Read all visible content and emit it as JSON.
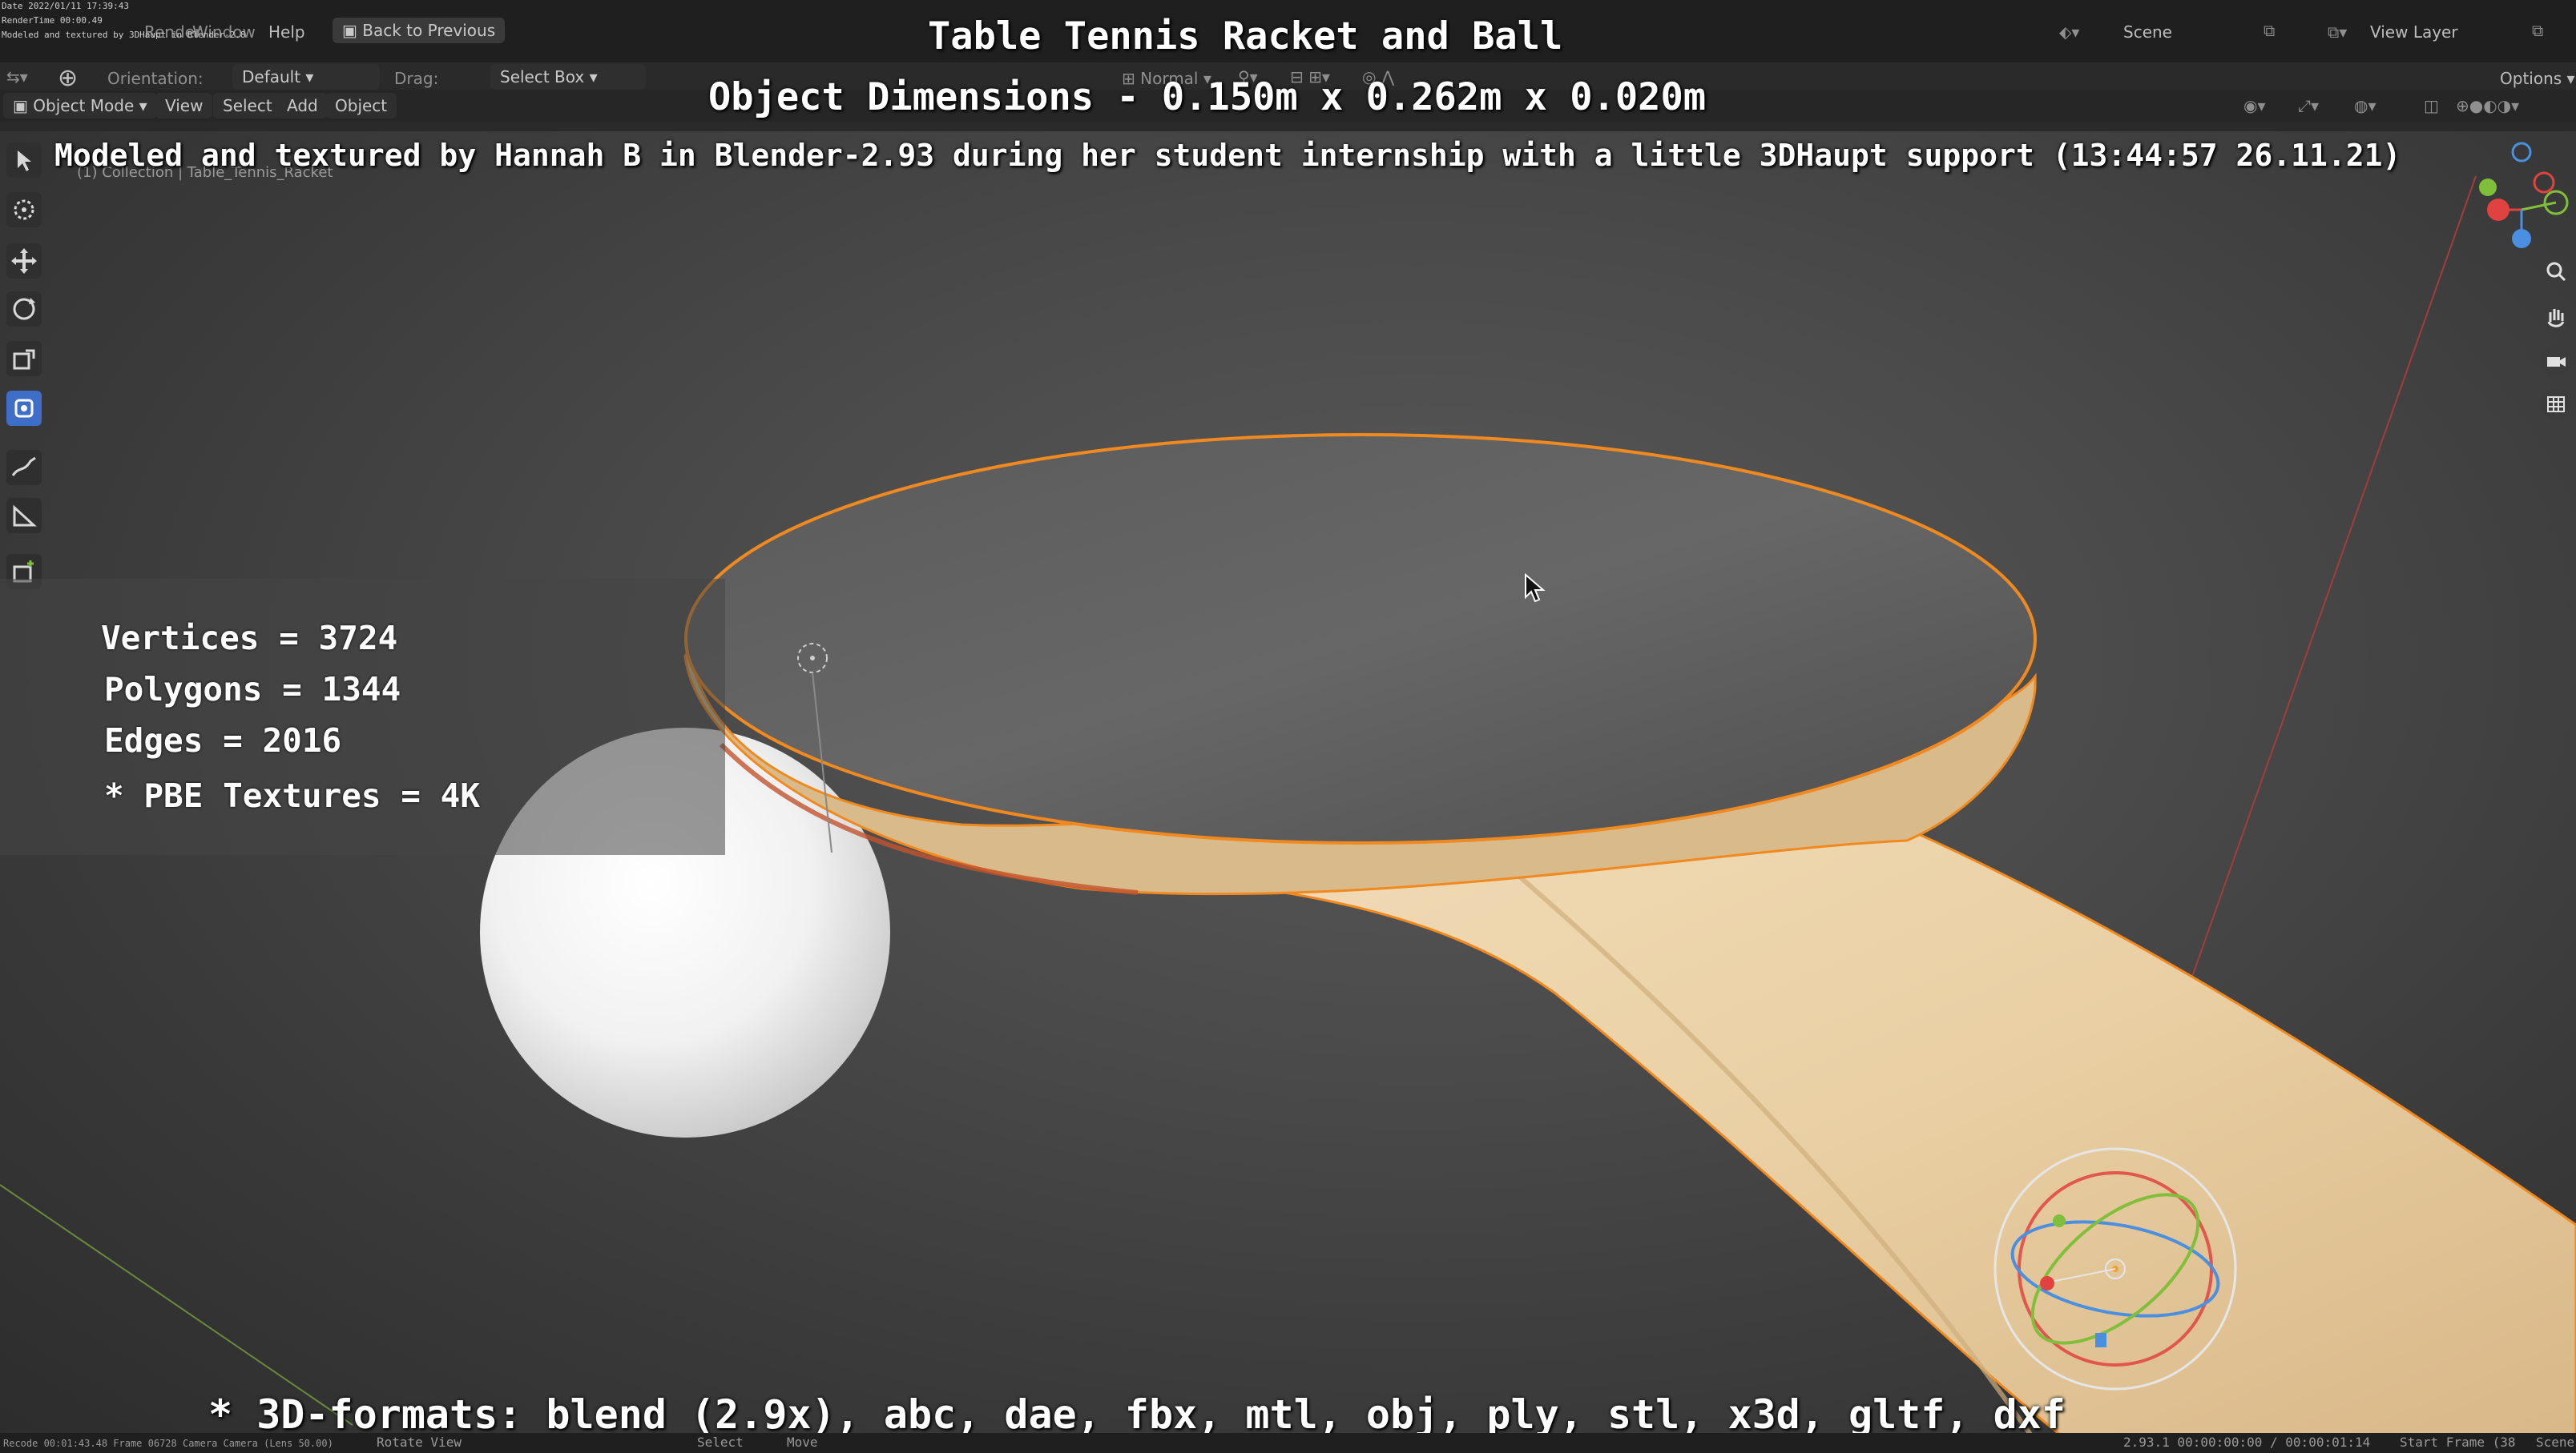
{
  "overlay": {
    "title": "Table Tennis Racket and Ball",
    "dimensions": "Object Dimensions -  0.150m x 0.262m x 0.020m",
    "credit": "Modeled and textured by Hannah B in Blender-2.93 during her student internship with a little 3DHaupt support (13:44:57 26.11.21)",
    "formats": "* 3D-formats: blend (2.9x), abc, dae, fbx, mtl, obj, ply, stl, x3d, gltf, dxf"
  },
  "stats": {
    "vertices": "Vertices = 3724",
    "polygons": "Polygons = 1344",
    "edges": "Edges = 2016",
    "textures": "* PBE Textures = 4K"
  },
  "recorder": {
    "date": "Date 2022/01/11 17:39:43",
    "render_time": "RenderTime 00:00.49",
    "note": "Modeled and textured by 3DHaupt in Blender-2.8"
  },
  "menu": {
    "render": "Render",
    "window": "Window",
    "help": "Help",
    "back": "Back to Previous",
    "scene": "Scene",
    "view_layer": "View Layer"
  },
  "tool_header": {
    "orientation_label": "Orientation:",
    "orientation_value": "Default",
    "drag_label": "Drag:",
    "drag_value": "Select Box",
    "pivot": "Normal",
    "options": "Options"
  },
  "viewport_header": {
    "mode": "Object Mode",
    "view": "View",
    "select": "Select",
    "add": "Add",
    "object": "Object"
  },
  "breadcrumb": "(1) Collection | Table_Tennis_Racket",
  "statusbar": {
    "left": "Recode 00:01:43.48  Frame 06728  Camera Camera (Lens 50.00)",
    "rotate": "Rotate View",
    "select": "Select",
    "move": "Move",
    "version": "2.93.1   00:00:00:00 / 00:00:01:14",
    "start": "Start Frame (38",
    "scene": "Scene"
  },
  "colors": {
    "selection_outline": "#f0891f",
    "active_tool": "#3f6ec9",
    "axis_x": "#e0433f",
    "axis_y": "#7fbf3a",
    "axis_z": "#4a8fe0"
  }
}
